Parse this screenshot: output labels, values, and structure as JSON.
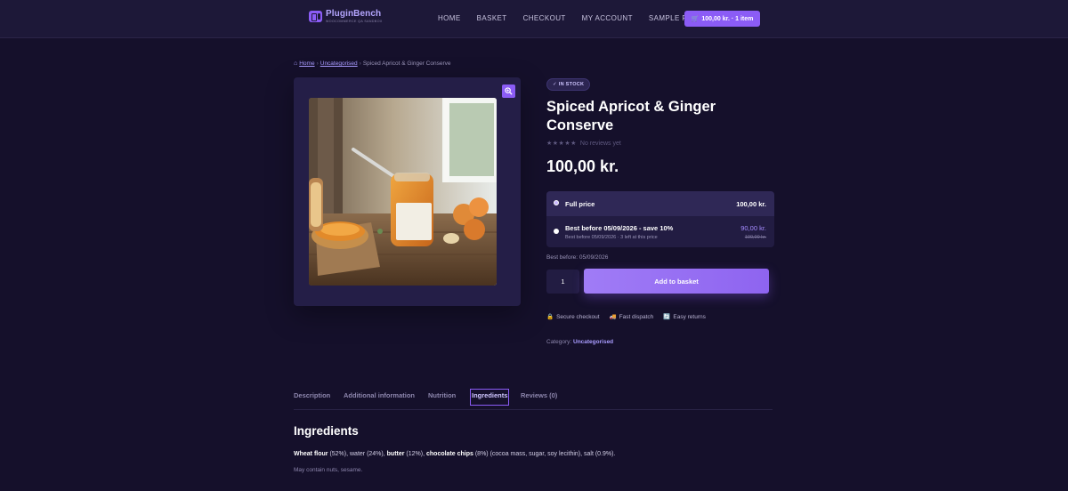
{
  "header": {
    "logo_name": "PluginBench",
    "logo_sub": "WOOCOMMERCE QA SANDBOX",
    "nav": [
      "HOME",
      "BASKET",
      "CHECKOUT",
      "MY ACCOUNT",
      "SAMPLE PAGE"
    ],
    "cart_label": "100,00 kr. · 1 item"
  },
  "breadcrumb": {
    "home": "Home",
    "category": "Uncategorised",
    "current": "Spiced Apricot & Ginger Conserve"
  },
  "product": {
    "stock_badge": "✓ IN STOCK",
    "title": "Spiced Apricot & Ginger Conserve",
    "stars": "★★★★★",
    "rating_text": "No reviews yet",
    "price": "100,00 kr.",
    "options": {
      "full": {
        "label": "Full price",
        "price": "100,00 kr."
      },
      "discount": {
        "label": "Best before 05/09/2026 - save 10%",
        "sub": "Best before 05/09/2026 · 3 left at this price",
        "price": "90,00 kr.",
        "old_price": "100,00 kr."
      }
    },
    "best_before": "Best before: 05/09/2026",
    "quantity": "1",
    "add_to_basket": "Add to basket",
    "trust": [
      "Secure checkout",
      "Fast dispatch",
      "Easy returns"
    ],
    "category_label": "Category:",
    "category_value": "Uncategorised"
  },
  "tabs": [
    "Description",
    "Additional information",
    "Nutrition",
    "Ingredients",
    "Reviews (0)"
  ],
  "active_tab": "Ingredients",
  "ingredients": {
    "heading": "Ingredients",
    "items": [
      {
        "name": "Wheat flour",
        "detail": " (52%), water (24%), "
      },
      {
        "name": "butter",
        "detail": " (12%), "
      },
      {
        "name": "chocolate chips",
        "detail": " (8%) (cocoa mass, sugar, soy lecithin), salt (0.9%)."
      }
    ],
    "allergens": "May contain nuts, sesame."
  },
  "colors": {
    "background": "#15102b",
    "header": "#1d1838",
    "accent": "#8b5cf6",
    "panel": "#241e47"
  }
}
